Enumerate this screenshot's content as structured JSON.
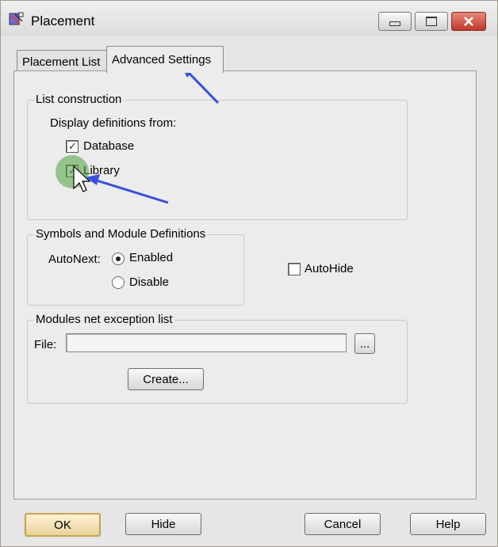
{
  "window": {
    "title": "Placement"
  },
  "tabs": [
    {
      "label": "Placement List"
    },
    {
      "label": "Advanced Settings"
    }
  ],
  "list_construction": {
    "title": "List construction",
    "display_from_label": "Display definitions from:",
    "database_label": "Database",
    "database_checked": true,
    "library_label": "Library",
    "library_checked": true
  },
  "symbols": {
    "title": "Symbols and Module Definitions",
    "autonext_label": "AutoNext:",
    "enabled_label": "Enabled",
    "disable_label": "Disable",
    "selected": "Enabled"
  },
  "autohide": {
    "label": "AutoHide",
    "checked": false
  },
  "modules": {
    "title": "Modules net exception list",
    "file_label": "File:",
    "file_value": "",
    "browse_label": "...",
    "create_label": "Create..."
  },
  "footer": {
    "ok_label": "OK",
    "hide_label": "Hide",
    "cancel_label": "Cancel",
    "help_label": "Help"
  },
  "colors": {
    "annotation_arrow": "#3a4fe0",
    "highlight": "#50a03c"
  }
}
